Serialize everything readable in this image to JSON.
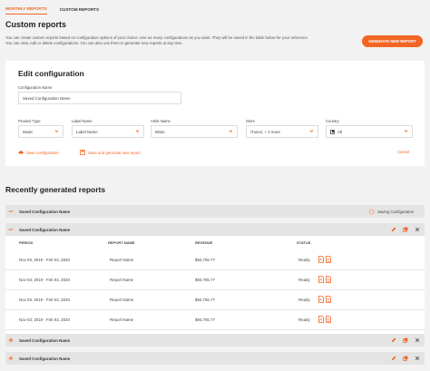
{
  "nav": {
    "tabs": [
      {
        "label": "MONTHLY REPORTS",
        "active": true
      },
      {
        "label": "CUSTOM REPORTS",
        "active": false
      }
    ]
  },
  "hero": {
    "title": "Custom reports",
    "description": "You can create custom reports based on configuration options of your choice. Use as many configurations as you want. They will be saved in the table below for your reference. You can view, edit or delete configurations. You can also use them to generate new reports at any time.",
    "generate_button": "GENERATE NEW REPORT"
  },
  "edit": {
    "title": "Edit configuration",
    "config_name_label": "Configuration Name",
    "config_name_value": "Saved Configuration Name",
    "filters": [
      {
        "label": "Product Type",
        "value": "Music"
      },
      {
        "label": "Label Name",
        "value": "Label Name"
      },
      {
        "label": "Artist Name",
        "value": "Mioto"
      },
      {
        "label": "Store",
        "value": "iTunes, + 2 more"
      },
      {
        "label": "Country",
        "value": "All"
      }
    ],
    "save_label": "Save configuration",
    "save_generate_label": "Save and generate new report",
    "cancel_label": "Cancel"
  },
  "recent": {
    "title": "Recently generated reports",
    "saving_label": "Saving Configuration",
    "config_rows": [
      "Saved Configuration Name",
      "Saved Configuration Name",
      "Saved Configuration Name",
      "Saved Configuration Name"
    ],
    "columns": [
      "PERIOD",
      "REPORT NAME",
      "REVENUE",
      "STATUS"
    ],
    "rows": [
      {
        "period": "Nov 03, 2019 - Feb 03, 2020",
        "report": "Report Name",
        "revenue": "$94,765.77",
        "status": "Ready"
      },
      {
        "period": "Nov 03, 2019 - Feb 03, 2020",
        "report": "Report Name",
        "revenue": "$94,765.77",
        "status": "Ready"
      },
      {
        "period": "Nov 03, 2019 - Feb 03, 2020",
        "report": "Report Name",
        "revenue": "$94,765.77",
        "status": "Ready"
      },
      {
        "period": "Nov 03, 2019 - Feb 03, 2020",
        "report": "Report Name",
        "revenue": "$94,765.77",
        "status": "Ready"
      }
    ]
  },
  "colors": {
    "accent": "#f26522",
    "page_bg": "#f2f2f2",
    "row_bg": "#e4e4e4"
  },
  "icons": [
    "cloud-save-icon",
    "save-generate-icon",
    "minus-icon",
    "plus-icon",
    "spinner-icon",
    "edit-icon",
    "copy-icon",
    "close-icon",
    "pdf-icon",
    "spreadsheet-icon",
    "chevron-down-icon"
  ]
}
